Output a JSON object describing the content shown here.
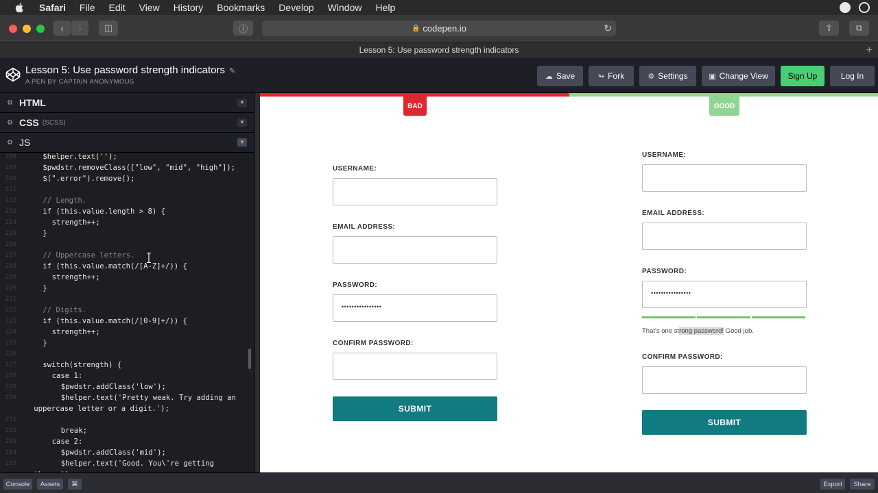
{
  "menubar": {
    "app": "Safari",
    "items": [
      "File",
      "Edit",
      "View",
      "History",
      "Bookmarks",
      "Develop",
      "Window",
      "Help"
    ]
  },
  "browser": {
    "url": "codepen.io",
    "tab_title": "Lesson 5: Use password strength indicators"
  },
  "codepen": {
    "pen_title": "Lesson 5: Use password strength indicators",
    "pen_author": "A PEN BY CAPTAIN ANONYMOUS",
    "buttons": {
      "save": "Save",
      "fork": "Fork",
      "settings": "Settings",
      "change_view": "Change View",
      "sign_up": "Sign Up",
      "log_in": "Log In"
    },
    "panes": [
      {
        "name": "HTML",
        "tag": ""
      },
      {
        "name": "CSS",
        "tag": "(SCSS)"
      },
      {
        "name": "JS",
        "tag": ""
      }
    ],
    "code_lines": [
      {
        "n": "208",
        "indent": "    ",
        "text": "$helper.text('');",
        "cmt": false
      },
      {
        "n": "209",
        "indent": "    ",
        "text": "$pwdstr.removeClass([\"low\", \"mid\", \"high\"]);",
        "cmt": false
      },
      {
        "n": "210",
        "indent": "    ",
        "text": "$(\".error\").remove();",
        "cmt": false
      },
      {
        "n": "211",
        "indent": "",
        "text": "",
        "cmt": false
      },
      {
        "n": "212",
        "indent": "    ",
        "text": "// Length.",
        "cmt": true
      },
      {
        "n": "213",
        "indent": "    ",
        "text": "if (this.value.length > 8) {",
        "cmt": false
      },
      {
        "n": "214",
        "indent": "      ",
        "text": "strength++;",
        "cmt": false
      },
      {
        "n": "215",
        "indent": "    ",
        "text": "}",
        "cmt": false
      },
      {
        "n": "216",
        "indent": "",
        "text": "",
        "cmt": false
      },
      {
        "n": "217",
        "indent": "    ",
        "text": "// Uppercase letters.",
        "cmt": true
      },
      {
        "n": "218",
        "indent": "    ",
        "text": "if (this.value.match(/[A-Z]+/)) {",
        "cmt": false
      },
      {
        "n": "219",
        "indent": "      ",
        "text": "strength++;",
        "cmt": false
      },
      {
        "n": "220",
        "indent": "    ",
        "text": "}",
        "cmt": false
      },
      {
        "n": "221",
        "indent": "",
        "text": "",
        "cmt": false
      },
      {
        "n": "222",
        "indent": "    ",
        "text": "// Digits.",
        "cmt": true
      },
      {
        "n": "223",
        "indent": "    ",
        "text": "if (this.value.match(/[0-9]+/)) {",
        "cmt": false
      },
      {
        "n": "224",
        "indent": "      ",
        "text": "strength++;",
        "cmt": false
      },
      {
        "n": "225",
        "indent": "    ",
        "text": "}",
        "cmt": false
      },
      {
        "n": "226",
        "indent": "",
        "text": "",
        "cmt": false
      },
      {
        "n": "227",
        "indent": "    ",
        "text": "switch(strength) {",
        "cmt": false
      },
      {
        "n": "228",
        "indent": "      ",
        "text": "case 1:",
        "cmt": false
      },
      {
        "n": "229",
        "indent": "        ",
        "text": "$pwdstr.addClass('low');",
        "cmt": false
      },
      {
        "n": "230",
        "indent": "        ",
        "text": "$helper.text('Pretty weak. Try adding an",
        "cmt": false
      },
      {
        "n": "",
        "indent": "  ",
        "text": "uppercase letter or a digit.');",
        "cmt": false
      },
      {
        "n": "231",
        "indent": "",
        "text": "",
        "cmt": false
      },
      {
        "n": "232",
        "indent": "        ",
        "text": "break;",
        "cmt": false
      },
      {
        "n": "233",
        "indent": "      ",
        "text": "case 2:",
        "cmt": false
      },
      {
        "n": "234",
        "indent": "        ",
        "text": "$pwdstr.addClass('mid');",
        "cmt": false
      },
      {
        "n": "235",
        "indent": "        ",
        "text": "$helper.text('Good. You\\'re getting",
        "cmt": false
      },
      {
        "n": "",
        "indent": "  ",
        "text": "there.');",
        "cmt": false
      }
    ],
    "bottom": {
      "console": "Console",
      "assets": "Assets",
      "shortcuts": "⌘",
      "export": "Export",
      "share": "Share"
    }
  },
  "preview": {
    "bad": {
      "badge": "BAD",
      "badge_color": "#e0262e",
      "username_label": "USERNAME:",
      "email_label": "EMAIL ADDRESS:",
      "password_label": "PASSWORD:",
      "password_value": "••••••••••••••••",
      "confirm_label": "CONFIRM PASSWORD:",
      "submit": "SUBMIT"
    },
    "good": {
      "badge": "GOOD",
      "badge_color": "#8fd694",
      "username_label": "USERNAME:",
      "email_label": "EMAIL ADDRESS:",
      "password_label": "PASSWORD:",
      "password_value": "••••••••••••••••",
      "strength_level": 3,
      "strength_max": 3,
      "helper_pre": "That's one st",
      "helper_hl": "rong password!",
      "helper_post": " Good job.",
      "confirm_label": "CONFIRM PASSWORD:",
      "submit": "SUBMIT"
    }
  },
  "colors": {
    "submit": "#107b80",
    "signup": "#47cf73",
    "meter": "#73c464"
  }
}
